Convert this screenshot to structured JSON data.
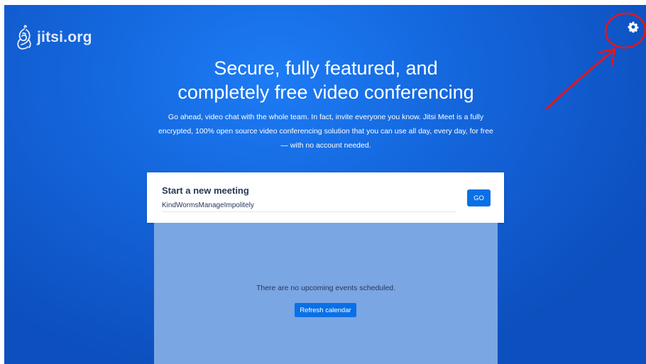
{
  "header": {
    "logo_text": "jitsi.org",
    "settings_icon": "gear-icon"
  },
  "hero": {
    "title_line1": "Secure, fully featured, and",
    "title_line2": "completely free video conferencing",
    "description": "Go ahead, video chat with the whole team. In fact, invite everyone you know. Jitsi Meet is a fully encrypted, 100% open source video conferencing solution that you can use all day, every day, for free — with no account needed."
  },
  "meeting_card": {
    "title": "Start a new meeting",
    "room_name_value": "KindWormsManageImpolitely",
    "go_label": "GO"
  },
  "calendar": {
    "message": "There are no upcoming events scheduled.",
    "refresh_label": "Refresh calendar"
  },
  "colors": {
    "background": "#1466dc",
    "accent": "#0a70e6",
    "calendar_panel": "#7ba6e4",
    "annotation": "#e8141c"
  }
}
